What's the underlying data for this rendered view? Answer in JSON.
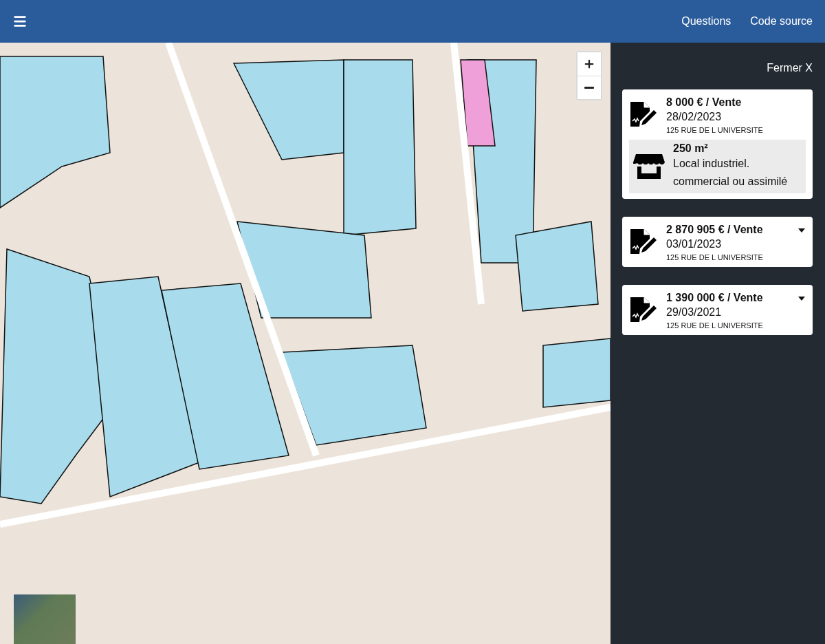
{
  "header": {
    "links": [
      "Questions",
      "Code source"
    ]
  },
  "panel": {
    "close": "Fermer X",
    "sales": [
      {
        "price": "8 000 € / Vente",
        "date": "28/02/2023",
        "address": "125 RUE DE L UNIVERSITE",
        "expanded": true,
        "premises": {
          "area": "250 m²",
          "type": "Local industriel. commercial ou assimilé"
        }
      },
      {
        "price": "2 870 905 € / Vente",
        "date": "03/01/2023",
        "address": "125 RUE DE L UNIVERSITE",
        "expanded": false
      },
      {
        "price": "1 390 000 € / Vente",
        "date": "29/03/2021",
        "address": "125 RUE DE L UNIVERSITE",
        "expanded": false
      }
    ]
  }
}
